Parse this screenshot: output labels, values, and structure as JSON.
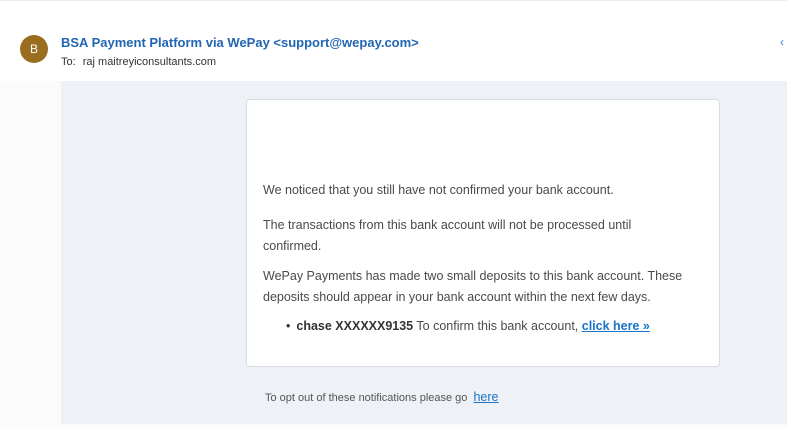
{
  "header": {
    "avatar_initial": "B",
    "sender": "BSA Payment Platform via WePay <support@wepay.com>",
    "to_label": "To:",
    "recipient": "raj maitreyiconsultants.com"
  },
  "message": {
    "line1": "We noticed that you still have not confirmed your bank account.",
    "line2": "The transactions from this bank account will not be processed until confirmed.",
    "line3": "WePay Payments has made two small deposits to this bank account. These deposits should appear in your bank account within the next few days.",
    "bullet": {
      "account": "chase XXXXXX9135",
      "text": " To confirm this bank account, ",
      "link": "click here »"
    }
  },
  "footer": {
    "optout_text": "To opt out of these notifications please go",
    "optout_link": "here"
  },
  "colors": {
    "sender": "#2266b3",
    "avatar": "#9a6d1f",
    "link": "#1a73c8",
    "body_bg": "#eef1f5"
  }
}
